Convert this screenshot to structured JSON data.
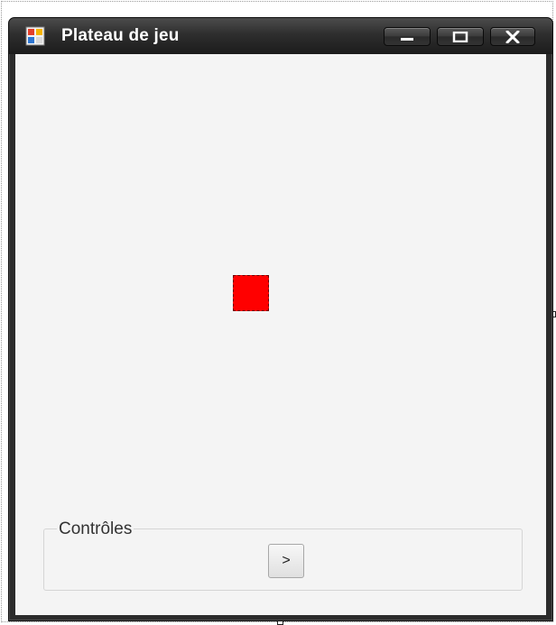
{
  "window": {
    "title": "Plateau de jeu",
    "buttons": {
      "minimize_icon": "minimize-icon",
      "maximize_icon": "maximize-icon",
      "close_icon": "close-icon"
    }
  },
  "board": {
    "piece_color": "#ff0000"
  },
  "controls": {
    "group_label": "Contrôles",
    "next_button_label": ">"
  }
}
